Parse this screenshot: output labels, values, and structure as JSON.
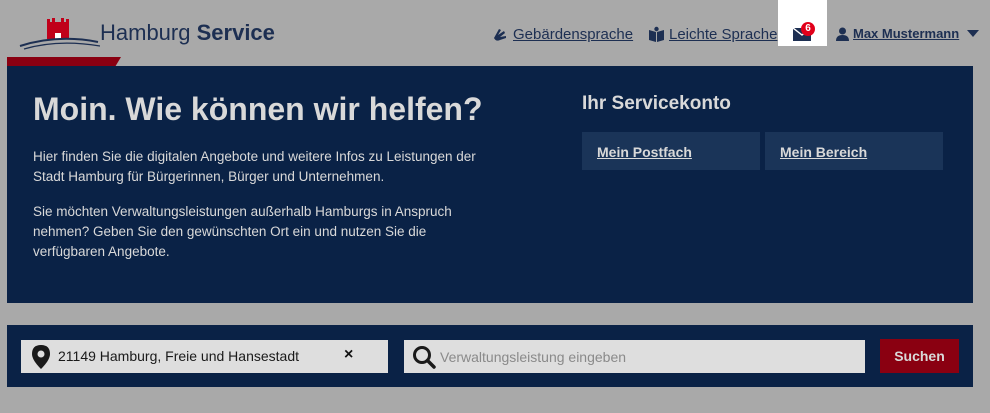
{
  "header": {
    "logo_text_regular": "Hamburg",
    "logo_text_bold": "Service",
    "sign_language_label": "Gebärdensprache",
    "easy_language_label": "Leichte Sprache",
    "mail_badge_count": "6",
    "user_name": "Max Mustermann"
  },
  "hero": {
    "title": "Moin. Wie können wir helfen?",
    "paragraph1": "Hier finden Sie die digitalen Angebote und weitere Infos zu Leistungen der Stadt Hamburg für Bürgerinnen, Bürger und Unternehmen.",
    "paragraph2": "Sie möchten Verwaltungsleistungen außerhalb Hamburgs in Anspruch nehmen? Geben Sie den gewünschten Ort ein und nutzen Sie die verfügbaren Angebote."
  },
  "servicekonto": {
    "title": "Ihr Servicekonto",
    "mailbox_label": "Mein Postfach",
    "area_label": "Mein Bereich"
  },
  "search": {
    "location_value": "21149 Hamburg, Freie und Hansestadt",
    "clear_symbol": "×",
    "service_placeholder": "Verwaltungsleistung eingeben",
    "submit_label": "Suchen"
  },
  "colors": {
    "navy": "#0a2246",
    "button_navy": "#1a3458",
    "accent_red": "#8a0011",
    "badge_red": "#e1001a"
  },
  "icons": [
    "hamburg-castle-icon",
    "sign-language-icon",
    "easy-language-icon",
    "mail-icon",
    "user-icon",
    "caret-down-icon",
    "location-pin-icon",
    "search-icon"
  ]
}
